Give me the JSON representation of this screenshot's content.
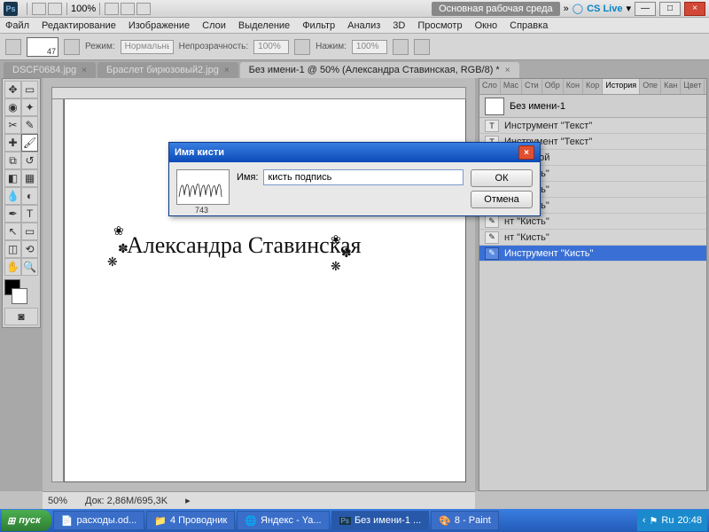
{
  "titlebar": {
    "zoom": "100%",
    "workspace": "Основная рабочая среда",
    "cslive": "CS Live"
  },
  "window": {
    "min": "—",
    "max": "□",
    "close": "×"
  },
  "menu": [
    "Файл",
    "Редактирование",
    "Изображение",
    "Слои",
    "Выделение",
    "Фильтр",
    "Анализ",
    "3D",
    "Просмотр",
    "Окно",
    "Справка"
  ],
  "options": {
    "brushSize": "47",
    "mode_label": "Режим:",
    "mode": "Нормальный",
    "opacity_label": "Непрозрачность:",
    "opacity": "100%",
    "flow_label": "Нажим:",
    "flow": "100%"
  },
  "tabs": [
    {
      "label": "DSCF0684.jpg",
      "active": false
    },
    {
      "label": "Браслет бирюзовый2.jpg",
      "active": false
    },
    {
      "label": "Без имени-1 @ 50% (Александра Ставинская, RGB/8) *",
      "active": true
    }
  ],
  "canvas": {
    "text": "Александра Ставинская"
  },
  "panel_tabs": [
    "Сло",
    "Мас",
    "Сти",
    "Обр",
    "Кон",
    "Кор",
    "История",
    "Опе",
    "Кан",
    "Цвет"
  ],
  "panel_active": "История",
  "history_doc": "Без имени-1",
  "history": [
    {
      "ico": "T",
      "label": "Инструмент \"Текст\""
    },
    {
      "ico": "T",
      "label": "Инструмент \"Текст\""
    },
    {
      "ico": "□",
      "label": "жать слой"
    },
    {
      "ico": "✎",
      "label": "нт \"Кисть\""
    },
    {
      "ico": "✎",
      "label": "нт \"Кисть\""
    },
    {
      "ico": "✎",
      "label": "нт \"Кисть\""
    },
    {
      "ico": "✎",
      "label": "нт \"Кисть\""
    },
    {
      "ico": "✎",
      "label": "нт \"Кисть\""
    },
    {
      "ico": "✎",
      "label": "Инструмент \"Кисть\"",
      "sel": true
    }
  ],
  "dialog": {
    "title": "Имя кисти",
    "name_label": "Имя:",
    "name_value": "кисть подпись",
    "preview_num": "743",
    "ok": "ОК",
    "cancel": "Отмена"
  },
  "status": {
    "zoom": "50%",
    "doc": "Док: 2,86M/695,3K"
  },
  "taskbar": {
    "start": "пуск",
    "items": [
      "расходы.od...",
      "4 Проводник",
      "Яндекс - Ya...",
      "Без имени-1 ...",
      "8 - Paint"
    ],
    "tray_lang": "Ru",
    "time": "20:48"
  }
}
